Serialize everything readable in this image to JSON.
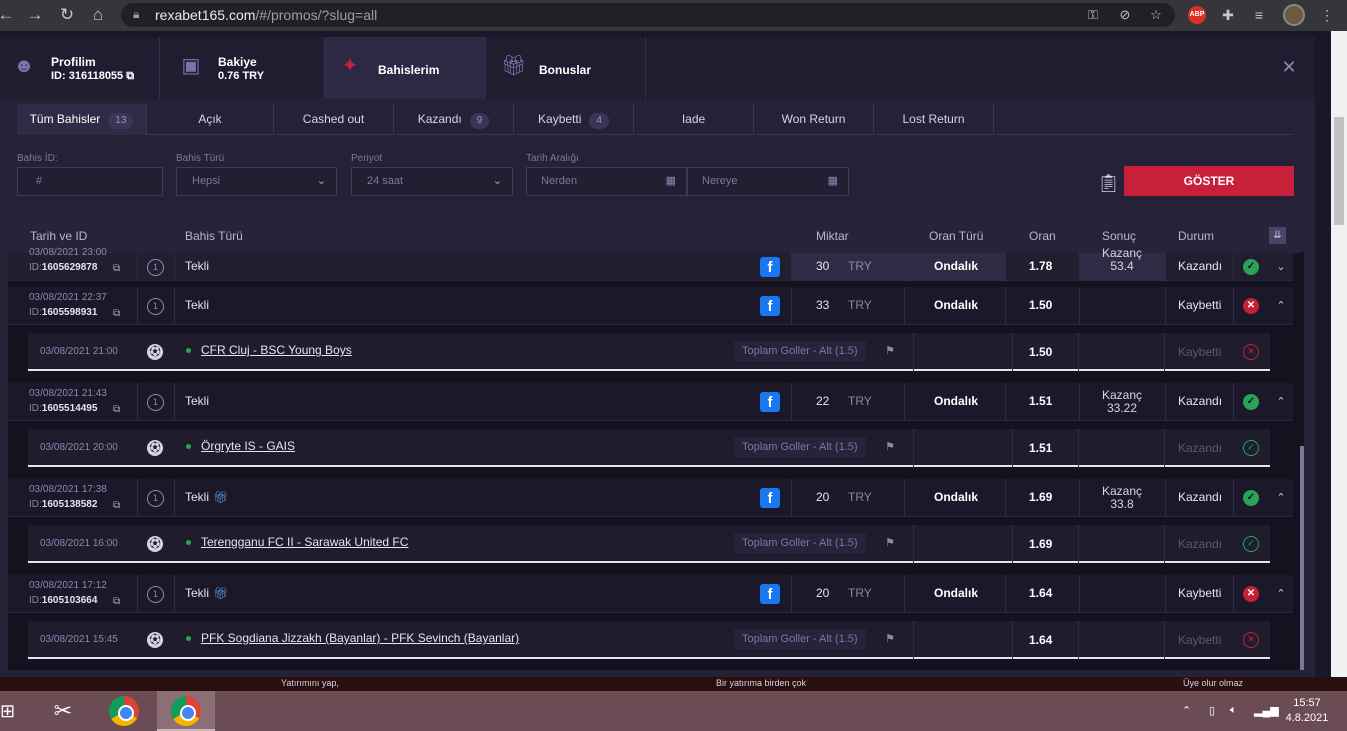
{
  "browser": {
    "url_host": "rexabet165.com",
    "url_path": "/#/promos/?slug=all",
    "abp_label": "ABP"
  },
  "header_tabs": {
    "profile_title": "Profilim",
    "profile_id": "ID: 316118055",
    "balance_title": "Bakiye",
    "balance_value": "0.76 TRY",
    "bets_title": "Bahislerim",
    "bonus_title": "Bonuslar"
  },
  "status_tabs": [
    {
      "label": "Tüm Bahisler",
      "count": "13"
    },
    {
      "label": "Açık",
      "count": ""
    },
    {
      "label": "Cashed out",
      "count": ""
    },
    {
      "label": "Kazandı",
      "count": "9"
    },
    {
      "label": "Kaybetti",
      "count": "4"
    },
    {
      "label": "Iade",
      "count": ""
    },
    {
      "label": "Won Return",
      "count": ""
    },
    {
      "label": "Lost Return",
      "count": ""
    }
  ],
  "filters": {
    "bet_id_label": "Bahis İD:",
    "bet_id_placeholder": "#",
    "bet_type_label": "Bahis Türü",
    "bet_type_value": "Hepsi",
    "period_label": "Periyot",
    "period_value": "24 saat",
    "date_range_label": "Tarih Aralığı",
    "from_placeholder": "Nerden",
    "to_placeholder": "Nereye",
    "show_button": "GÖSTER"
  },
  "table_headers": {
    "date_id": "Tarih ve ID",
    "bet_type": "Bahis Türü",
    "amount": "Miktar",
    "odds_type": "Oran Türü",
    "odds": "Oran",
    "result": "Sonuç",
    "status": "Durum"
  },
  "bets": [
    {
      "date": "03/08/2021 23:00",
      "id_prefix": "ID:",
      "id": "1605629878",
      "num": "1",
      "type": "Tekli",
      "gift": false,
      "amount": "30",
      "currency": "TRY",
      "odds_type": "Ondalık",
      "odds": "1.78",
      "result_label": "Kazanç",
      "result_value": "53.4",
      "status": "Kazandı",
      "outcome": "win",
      "caret": "⌄"
    },
    {
      "date": "03/08/2021 22:37",
      "id_prefix": "ID:",
      "id": "1605598931",
      "num": "1",
      "type": "Tekli",
      "gift": false,
      "amount": "33",
      "currency": "TRY",
      "odds_type": "Ondalık",
      "odds": "1.50",
      "result_label": "",
      "result_value": "",
      "status": "Kaybetti",
      "outcome": "lose",
      "caret": "⌃",
      "selection": {
        "date": "03/08/2021 21:00",
        "match": "CFR Cluj - BSC Young Boys",
        "market": "Toplam Goller - Alt (1.5)",
        "odds": "1.50",
        "status": "Kaybetti",
        "outcome": "lose"
      }
    },
    {
      "date": "03/08/2021 21:43",
      "id_prefix": "ID:",
      "id": "1605514495",
      "num": "1",
      "type": "Tekli",
      "gift": false,
      "amount": "22",
      "currency": "TRY",
      "odds_type": "Ondalık",
      "odds": "1.51",
      "result_label": "Kazanç",
      "result_value": "33.22",
      "status": "Kazandı",
      "outcome": "win",
      "caret": "⌃",
      "selection": {
        "date": "03/08/2021 20:00",
        "match": "Örgryte IS - GAIS",
        "market": "Toplam Goller - Alt (1.5)",
        "odds": "1.51",
        "status": "Kazandı",
        "outcome": "win"
      }
    },
    {
      "date": "03/08/2021 17:38",
      "id_prefix": "ID:",
      "id": "1605138582",
      "num": "1",
      "type": "Tekli",
      "gift": true,
      "amount": "20",
      "currency": "TRY",
      "odds_type": "Ondalık",
      "odds": "1.69",
      "result_label": "Kazanç",
      "result_value": "33.8",
      "status": "Kazandı",
      "outcome": "win",
      "caret": "⌃",
      "selection": {
        "date": "03/08/2021 16:00",
        "match": "Terengganu FC II - Sarawak United FC",
        "market": "Toplam Goller - Alt (1.5)",
        "odds": "1.69",
        "status": "Kazandı",
        "outcome": "win"
      }
    },
    {
      "date": "03/08/2021 17:12",
      "id_prefix": "ID:",
      "id": "1605103664",
      "num": "1",
      "type": "Tekli",
      "gift": true,
      "amount": "20",
      "currency": "TRY",
      "odds_type": "Ondalık",
      "odds": "1.64",
      "result_label": "",
      "result_value": "",
      "status": "Kaybetti",
      "outcome": "lose",
      "caret": "⌃",
      "selection": {
        "date": "03/08/2021 15:45",
        "match": "PFK Sogdiana Jizzakh (Bayanlar) - PFK Sevinch (Bayanlar)",
        "market": "Toplam Goller - Alt (1.5)",
        "odds": "1.64",
        "status": "Kaybetti",
        "outcome": "lose"
      }
    }
  ],
  "banner": {
    "text_1": "Yatırımını yap,",
    "text_2": "Bir yatırıma birden çok",
    "text_3": "Üye olur olmaz"
  },
  "taskbar": {
    "time": "15:57",
    "date": "4.8.2021"
  },
  "colors": {
    "accent_red": "#c81f3b",
    "win_green": "#2aa35a",
    "bg_dark": "#1a1728"
  }
}
